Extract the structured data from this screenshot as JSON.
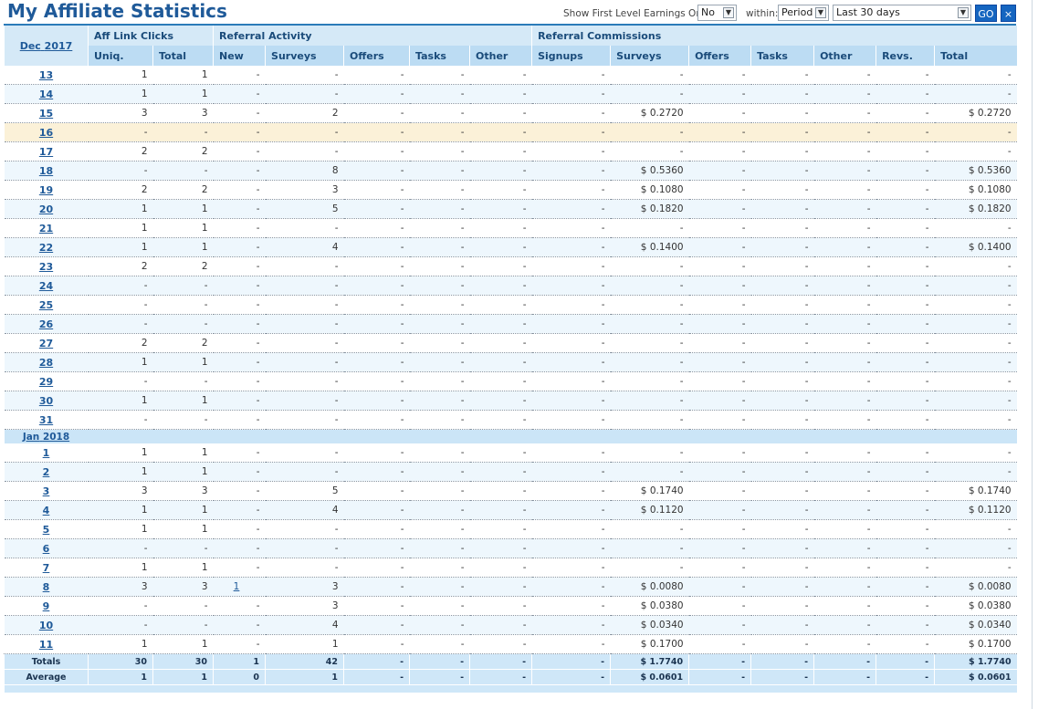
{
  "page": {
    "title": "My Affiliate Statistics"
  },
  "controls": {
    "first_level_label": "Show First Level Earnings Only:",
    "first_level_value": "No",
    "within_label": "within:",
    "within_value": "Period",
    "range_value": "Last 30 days",
    "go_label": "GO",
    "close_label": "×"
  },
  "headers": {
    "groups": [
      "Aff Link Clicks",
      "Referral Activity",
      "Referral Commissions"
    ],
    "columns": [
      "Uniq.",
      "Total",
      "New",
      "Surveys",
      "Offers",
      "Tasks",
      "Other",
      "Signups",
      "Surveys",
      "Offers",
      "Tasks",
      "Other",
      "Revs.",
      "Total"
    ]
  },
  "months": [
    {
      "label": "Dec",
      "year": "2017"
    },
    {
      "label": "Jan",
      "year": "2018"
    }
  ],
  "rows_dec": [
    {
      "d": "13",
      "v": [
        "1",
        "1",
        "-",
        "-",
        "-",
        "-",
        "-",
        "-",
        "-",
        "-",
        "-",
        "-",
        "-",
        "-"
      ]
    },
    {
      "d": "14",
      "v": [
        "1",
        "1",
        "-",
        "-",
        "-",
        "-",
        "-",
        "-",
        "-",
        "-",
        "-",
        "-",
        "-",
        "-"
      ]
    },
    {
      "d": "15",
      "v": [
        "3",
        "3",
        "-",
        "2",
        "-",
        "-",
        "-",
        "-",
        "$ 0.2720",
        "-",
        "-",
        "-",
        "-",
        "$ 0.2720"
      ]
    },
    {
      "d": "16",
      "v": [
        "-",
        "-",
        "-",
        "-",
        "-",
        "-",
        "-",
        "-",
        "-",
        "-",
        "-",
        "-",
        "-",
        "-"
      ],
      "hl": true
    },
    {
      "d": "17",
      "v": [
        "2",
        "2",
        "-",
        "-",
        "-",
        "-",
        "-",
        "-",
        "-",
        "-",
        "-",
        "-",
        "-",
        "-"
      ]
    },
    {
      "d": "18",
      "v": [
        "-",
        "-",
        "-",
        "8",
        "-",
        "-",
        "-",
        "-",
        "$ 0.5360",
        "-",
        "-",
        "-",
        "-",
        "$ 0.5360"
      ]
    },
    {
      "d": "19",
      "v": [
        "2",
        "2",
        "-",
        "3",
        "-",
        "-",
        "-",
        "-",
        "$ 0.1080",
        "-",
        "-",
        "-",
        "-",
        "$ 0.1080"
      ]
    },
    {
      "d": "20",
      "v": [
        "1",
        "1",
        "-",
        "5",
        "-",
        "-",
        "-",
        "-",
        "$ 0.1820",
        "-",
        "-",
        "-",
        "-",
        "$ 0.1820"
      ]
    },
    {
      "d": "21",
      "v": [
        "1",
        "1",
        "-",
        "-",
        "-",
        "-",
        "-",
        "-",
        "-",
        "-",
        "-",
        "-",
        "-",
        "-"
      ]
    },
    {
      "d": "22",
      "v": [
        "1",
        "1",
        "-",
        "4",
        "-",
        "-",
        "-",
        "-",
        "$ 0.1400",
        "-",
        "-",
        "-",
        "-",
        "$ 0.1400"
      ]
    },
    {
      "d": "23",
      "v": [
        "2",
        "2",
        "-",
        "-",
        "-",
        "-",
        "-",
        "-",
        "-",
        "-",
        "-",
        "-",
        "-",
        "-"
      ]
    },
    {
      "d": "24",
      "v": [
        "-",
        "-",
        "-",
        "-",
        "-",
        "-",
        "-",
        "-",
        "-",
        "-",
        "-",
        "-",
        "-",
        "-"
      ]
    },
    {
      "d": "25",
      "v": [
        "-",
        "-",
        "-",
        "-",
        "-",
        "-",
        "-",
        "-",
        "-",
        "-",
        "-",
        "-",
        "-",
        "-"
      ]
    },
    {
      "d": "26",
      "v": [
        "-",
        "-",
        "-",
        "-",
        "-",
        "-",
        "-",
        "-",
        "-",
        "-",
        "-",
        "-",
        "-",
        "-"
      ]
    },
    {
      "d": "27",
      "v": [
        "2",
        "2",
        "-",
        "-",
        "-",
        "-",
        "-",
        "-",
        "-",
        "-",
        "-",
        "-",
        "-",
        "-"
      ]
    },
    {
      "d": "28",
      "v": [
        "1",
        "1",
        "-",
        "-",
        "-",
        "-",
        "-",
        "-",
        "-",
        "-",
        "-",
        "-",
        "-",
        "-"
      ]
    },
    {
      "d": "29",
      "v": [
        "-",
        "-",
        "-",
        "-",
        "-",
        "-",
        "-",
        "-",
        "-",
        "-",
        "-",
        "-",
        "-",
        "-"
      ]
    },
    {
      "d": "30",
      "v": [
        "1",
        "1",
        "-",
        "-",
        "-",
        "-",
        "-",
        "-",
        "-",
        "-",
        "-",
        "-",
        "-",
        "-"
      ]
    },
    {
      "d": "31",
      "v": [
        "-",
        "-",
        "-",
        "-",
        "-",
        "-",
        "-",
        "-",
        "-",
        "-",
        "-",
        "-",
        "-",
        "-"
      ]
    }
  ],
  "rows_jan": [
    {
      "d": "1",
      "v": [
        "1",
        "1",
        "-",
        "-",
        "-",
        "-",
        "-",
        "-",
        "-",
        "-",
        "-",
        "-",
        "-",
        "-"
      ]
    },
    {
      "d": "2",
      "v": [
        "1",
        "1",
        "-",
        "-",
        "-",
        "-",
        "-",
        "-",
        "-",
        "-",
        "-",
        "-",
        "-",
        "-"
      ]
    },
    {
      "d": "3",
      "v": [
        "3",
        "3",
        "-",
        "5",
        "-",
        "-",
        "-",
        "-",
        "$ 0.1740",
        "-",
        "-",
        "-",
        "-",
        "$ 0.1740"
      ]
    },
    {
      "d": "4",
      "v": [
        "1",
        "1",
        "-",
        "4",
        "-",
        "-",
        "-",
        "-",
        "$ 0.1120",
        "-",
        "-",
        "-",
        "-",
        "$ 0.1120"
      ]
    },
    {
      "d": "5",
      "v": [
        "1",
        "1",
        "-",
        "-",
        "-",
        "-",
        "-",
        "-",
        "-",
        "-",
        "-",
        "-",
        "-",
        "-"
      ]
    },
    {
      "d": "6",
      "v": [
        "-",
        "-",
        "-",
        "-",
        "-",
        "-",
        "-",
        "-",
        "-",
        "-",
        "-",
        "-",
        "-",
        "-"
      ]
    },
    {
      "d": "7",
      "v": [
        "1",
        "1",
        "-",
        "-",
        "-",
        "-",
        "-",
        "-",
        "-",
        "-",
        "-",
        "-",
        "-",
        "-"
      ]
    },
    {
      "d": "8",
      "v": [
        "3",
        "3",
        "1",
        "3",
        "-",
        "-",
        "-",
        "-",
        "$ 0.0080",
        "-",
        "-",
        "-",
        "-",
        "$ 0.0080"
      ],
      "link_new": true
    },
    {
      "d": "9",
      "v": [
        "-",
        "-",
        "-",
        "3",
        "-",
        "-",
        "-",
        "-",
        "$ 0.0380",
        "-",
        "-",
        "-",
        "-",
        "$ 0.0380"
      ]
    },
    {
      "d": "10",
      "v": [
        "-",
        "-",
        "-",
        "4",
        "-",
        "-",
        "-",
        "-",
        "$ 0.0340",
        "-",
        "-",
        "-",
        "-",
        "$ 0.0340"
      ]
    },
    {
      "d": "11",
      "v": [
        "1",
        "1",
        "-",
        "1",
        "-",
        "-",
        "-",
        "-",
        "$ 0.1700",
        "-",
        "-",
        "-",
        "-",
        "$ 0.1700"
      ]
    }
  ],
  "totals": {
    "label": "Totals",
    "v": [
      "30",
      "30",
      "1",
      "42",
      "-",
      "-",
      "-",
      "-",
      "$ 1.7740",
      "-",
      "-",
      "-",
      "-",
      "$ 1.7740"
    ]
  },
  "average": {
    "label": "Average",
    "v": [
      "1",
      "1",
      "0",
      "1",
      "-",
      "-",
      "-",
      "-",
      "$ 0.0601",
      "-",
      "-",
      "-",
      "-",
      "$ 0.0601"
    ]
  }
}
